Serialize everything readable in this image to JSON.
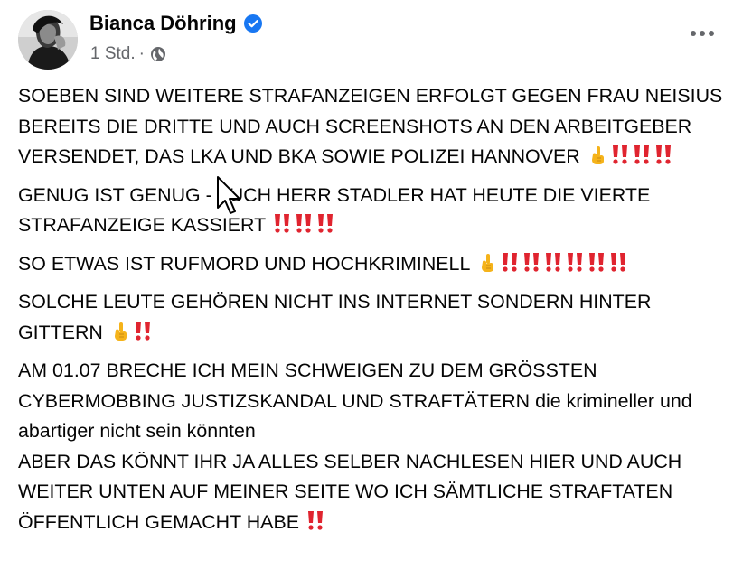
{
  "post": {
    "author": {
      "name": "Bianca Döhring",
      "verified": true
    },
    "meta": {
      "time": "1 Std.",
      "separator": "·",
      "privacy_icon": "globe-icon"
    },
    "more_icon": "more-horizontal-icon",
    "colors": {
      "text": "#050505",
      "secondary": "#65676b",
      "verified": "#1877f2",
      "exclamation": "#e0242f",
      "finger": "#f5b31a"
    },
    "paragraphs": {
      "p1": {
        "text": "SOEBEN SIND WEITERE STRAFANZEIGEN ERFOLGT GEGEN FRAU NEISIUS BEREITS DIE DRITTE UND AUCH SCREENSHOTS AN DEN ARBEITGEBER VERSENDET, DAS LKA UND BKA SOWIE POLIZEI HANNOVER",
        "emojis": [
          "pointing-up-icon",
          "double-exclamation-icon",
          "double-exclamation-icon",
          "double-exclamation-icon"
        ]
      },
      "p2": {
        "text": "GENUG IST GENUG - AUCH HERR STADLER HAT HEUTE DIE VIERTE STRAFANZEIGE KASSIERT",
        "emojis": [
          "double-exclamation-icon",
          "double-exclamation-icon",
          "double-exclamation-icon"
        ]
      },
      "p3": {
        "text": "SO ETWAS IST RUFMORD UND HOCHKRIMINELL",
        "emojis": [
          "pointing-up-icon",
          "double-exclamation-icon",
          "double-exclamation-icon",
          "double-exclamation-icon",
          "double-exclamation-icon",
          "double-exclamation-icon",
          "double-exclamation-icon"
        ]
      },
      "p4": {
        "text": "SOLCHE LEUTE GEHÖREN NICHT INS INTERNET SONDERN HINTER GITTERN",
        "emojis": [
          "pointing-up-icon",
          "double-exclamation-icon"
        ]
      },
      "p5": {
        "text": "AM 01.07 BRECHE ICH MEIN SCHWEIGEN ZU DEM GRÖSSTEN CYBERMOBBING JUSTIZSKANDAL UND STRAFTÄTERN die krimineller und abartiger nicht sein könnten"
      },
      "p6": {
        "text": "ABER DAS KÖNNT IHR JA ALLES SELBER NACHLESEN HIER UND AUCH WEITER UNTEN AUF MEINER SEITE WO ICH SÄMTLICHE STRAFTATEN ÖFFENTLICH GEMACHT HABE",
        "emojis": [
          "double-exclamation-icon"
        ]
      }
    }
  }
}
